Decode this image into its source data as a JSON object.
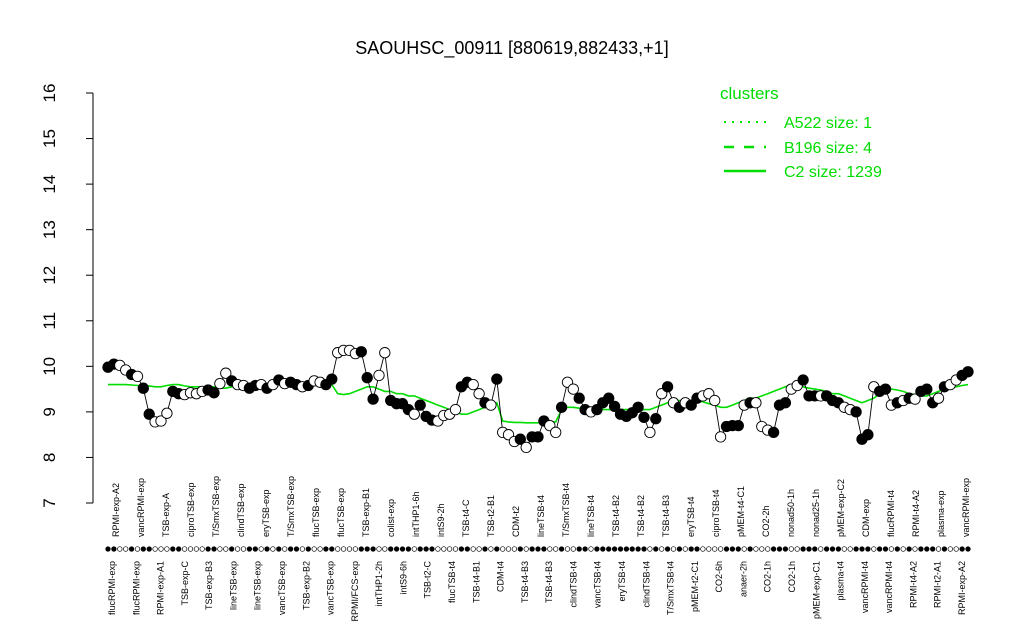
{
  "chart_data": {
    "type": "line",
    "title": "SAOUHSC_00911 [880619,882433,+1]",
    "ylim": [
      7,
      16
    ],
    "y_ticks": [
      7,
      8,
      9,
      10,
      11,
      12,
      13,
      14,
      15,
      16
    ],
    "legend": {
      "title": "clusters",
      "placement": "top-right",
      "entries": [
        {
          "label": "A522 size: 1",
          "style": "dotted"
        },
        {
          "label": "B196 size: 4",
          "style": "dashed"
        },
        {
          "label": "C2 size: 1239",
          "style": "solid"
        }
      ]
    },
    "x_labels_upper": [
      "RPMI-exp-A2",
      "vancRPMI-exp",
      "TSB-exp-A",
      "ciproTSB-exp",
      "T/SmxTSB-exp",
      "clindTSB-exp",
      "eryTSB-exp",
      "T/SmxTSB-exp",
      "flucTSB-exp",
      "flucTSB-exp",
      "TSB-exp-B1",
      "colist-exp",
      "intTHP1-6h",
      "intS9-2h",
      "TSB-t4-C",
      "TSB-t2-B1",
      "CDM-t2",
      "lineTSB-t4",
      "T/SmxTSB-t4",
      "lineTSB-t4",
      "TSB-t4-B2",
      "TSB-t4-B2",
      "TSB-t4-B3",
      "eryTSB-t4",
      "ciproTSB-t4",
      "pMEM-t4-C1",
      "CO2-2h",
      "nonad50-1h",
      "nonad25-1h",
      "pMEM-exp-C2",
      "CDM-exp",
      "flucRPMI-t4",
      "RPMI-t4-A2",
      "plasma-exp",
      "vancRPMI-exp"
    ],
    "x_labels_lower": [
      "flucRPMI-exp",
      "flucRPMI-exp",
      "RPMI-exp-A1",
      "TSB-exp-C",
      "TSB-exp-B3",
      "lineTSB-exp",
      "lineTSB-exp",
      "vancTSB-exp",
      "TSB-exp-B2",
      "vancTSB-exp",
      "RPMI/FCS-exp",
      "intTHP1-2h",
      "intS9-6h",
      "TSB-t2-C",
      "flucTSB-t4",
      "TSB-t4-B1",
      "CDM-t4",
      "TSB-t4-B3",
      "TSB-t4-B3",
      "clindTSB-t4",
      "vancTSB-t4",
      "eryTSB-t4",
      "clindTSB-t4",
      "T/SmxTSB-t4",
      "pMEM-t2-C1",
      "CO2-6h",
      "anaer-2h",
      "CO2-1h",
      "CO2-1h",
      "pMEM-exp-C1",
      "plasma-t4",
      "vancRPMI-t4",
      "vancRPMI-t4",
      "RPMI-t4-A2",
      "RPMI-t2-A1",
      "RPMI-exp-A2"
    ],
    "series": [
      {
        "values": [
          9.98,
          10.05,
          10.02,
          9.92,
          9.82,
          9.78,
          9.52,
          8.95,
          8.78,
          8.8,
          8.97,
          9.45,
          9.4,
          9.38,
          9.42,
          9.4,
          9.45,
          9.48,
          9.42,
          9.62,
          9.85,
          9.68,
          9.6,
          9.58,
          9.52,
          9.58,
          9.6,
          9.52,
          9.6,
          9.7,
          9.62,
          9.65,
          9.6,
          9.55,
          9.58,
          9.68,
          9.65,
          9.6,
          9.72,
          10.3,
          10.35,
          10.35,
          10.28,
          10.32,
          9.75,
          9.28,
          9.8,
          10.3,
          9.25,
          9.18,
          9.18,
          9.05,
          8.95,
          9.15,
          8.9,
          8.82,
          8.8,
          8.92,
          8.95,
          9.05,
          9.55,
          9.65,
          9.6,
          9.4,
          9.2,
          9.15,
          9.72,
          8.55,
          8.5,
          8.35,
          8.4,
          8.22,
          8.45,
          8.45,
          8.8,
          8.7,
          8.55,
          9.1,
          9.65,
          9.5,
          9.3,
          9.05,
          9.0,
          9.05,
          9.2,
          9.3,
          9.12,
          8.95,
          8.9,
          8.98,
          9.1,
          8.88,
          8.55,
          8.85,
          9.4,
          9.55,
          9.2,
          9.1,
          9.2,
          9.15,
          9.3,
          9.35,
          9.4,
          9.25,
          8.45,
          8.68,
          8.7,
          8.7,
          9.15,
          9.2,
          9.2,
          8.68,
          8.6,
          8.55,
          9.15,
          9.2,
          9.5,
          9.58,
          9.7,
          9.35,
          9.35,
          9.35,
          9.35,
          9.25,
          9.2,
          9.1,
          9.05,
          9.0,
          8.4,
          8.5,
          9.55,
          9.45,
          9.5,
          9.15,
          9.2,
          9.25,
          9.3,
          9.28,
          9.45,
          9.5,
          9.2,
          9.3,
          9.55,
          9.6,
          9.7,
          9.8,
          9.88
        ],
        "filled": [
          1,
          1,
          0,
          0,
          1,
          0,
          1,
          1,
          0,
          0,
          0,
          1,
          1,
          0,
          0,
          0,
          0,
          1,
          1,
          0,
          0,
          1,
          0,
          0,
          1,
          1,
          0,
          1,
          0,
          1,
          0,
          1,
          1,
          0,
          1,
          0,
          0,
          1,
          1,
          0,
          0,
          0,
          0,
          1,
          1,
          1,
          0,
          0,
          1,
          1,
          1,
          1,
          0,
          1,
          1,
          1,
          0,
          0,
          0,
          0,
          1,
          1,
          0,
          0,
          1,
          0,
          1,
          0,
          0,
          0,
          1,
          0,
          1,
          1,
          1,
          0,
          0,
          1,
          0,
          0,
          1,
          1,
          0,
          1,
          1,
          1,
          1,
          1,
          1,
          1,
          1,
          1,
          0,
          1,
          0,
          1,
          0,
          1,
          0,
          1,
          1,
          0,
          0,
          0,
          0,
          1,
          1,
          1,
          0,
          1,
          0,
          0,
          0,
          1,
          1,
          1,
          0,
          0,
          1,
          1,
          1,
          0,
          1,
          1,
          1,
          0,
          0,
          1,
          1,
          1,
          0,
          1,
          1,
          0,
          1,
          0,
          1,
          0,
          1,
          1,
          1,
          0,
          1,
          0,
          0,
          1,
          1
        ],
        "trend": [
          9.6,
          9.6,
          9.6,
          9.6,
          9.59,
          9.58,
          9.58,
          9.57,
          9.55,
          9.55,
          9.58,
          9.6,
          9.6,
          9.57,
          9.55,
          9.55,
          9.55,
          9.55,
          9.55,
          9.52,
          9.52,
          9.55,
          9.57,
          9.58,
          9.57,
          9.57,
          9.57,
          9.57,
          9.58,
          9.6,
          9.6,
          9.62,
          9.6,
          9.6,
          9.58,
          9.6,
          9.62,
          9.62,
          9.6,
          9.4,
          9.38,
          9.4,
          9.45,
          9.5,
          9.55,
          9.55,
          9.5,
          9.45,
          9.45,
          9.4,
          9.4,
          9.35,
          9.35,
          9.3,
          9.25,
          9.2,
          9.15,
          9.1,
          9.05,
          9.0,
          8.95,
          8.95,
          9.0,
          9.05,
          9.1,
          9.15,
          9.2,
          8.8,
          8.78,
          8.77,
          8.77,
          8.76,
          8.76,
          8.76,
          8.78,
          8.78,
          8.78,
          9.05,
          9.1,
          9.1,
          9.08,
          9.05,
          9.0,
          9.05,
          9.05,
          9.05,
          9.05,
          9.05,
          9.05,
          9.05,
          9.02,
          9.05,
          9.05,
          9.1,
          9.15,
          9.2,
          9.25,
          9.25,
          9.25,
          9.25,
          9.25,
          9.22,
          9.18,
          9.15,
          9.1,
          9.1,
          9.15,
          9.2,
          9.25,
          9.3,
          9.3,
          9.35,
          9.4,
          9.45,
          9.5,
          9.55,
          9.6,
          9.55,
          9.55,
          9.52,
          9.5,
          9.48,
          9.45,
          9.4,
          9.4,
          9.35,
          9.3,
          9.25,
          9.2,
          9.25,
          9.3,
          9.4,
          9.5,
          9.5,
          9.48,
          9.45,
          9.4,
          9.38,
          9.35,
          9.35,
          9.4,
          9.45,
          9.5,
          9.55,
          9.55,
          9.58,
          9.6
        ]
      }
    ]
  }
}
